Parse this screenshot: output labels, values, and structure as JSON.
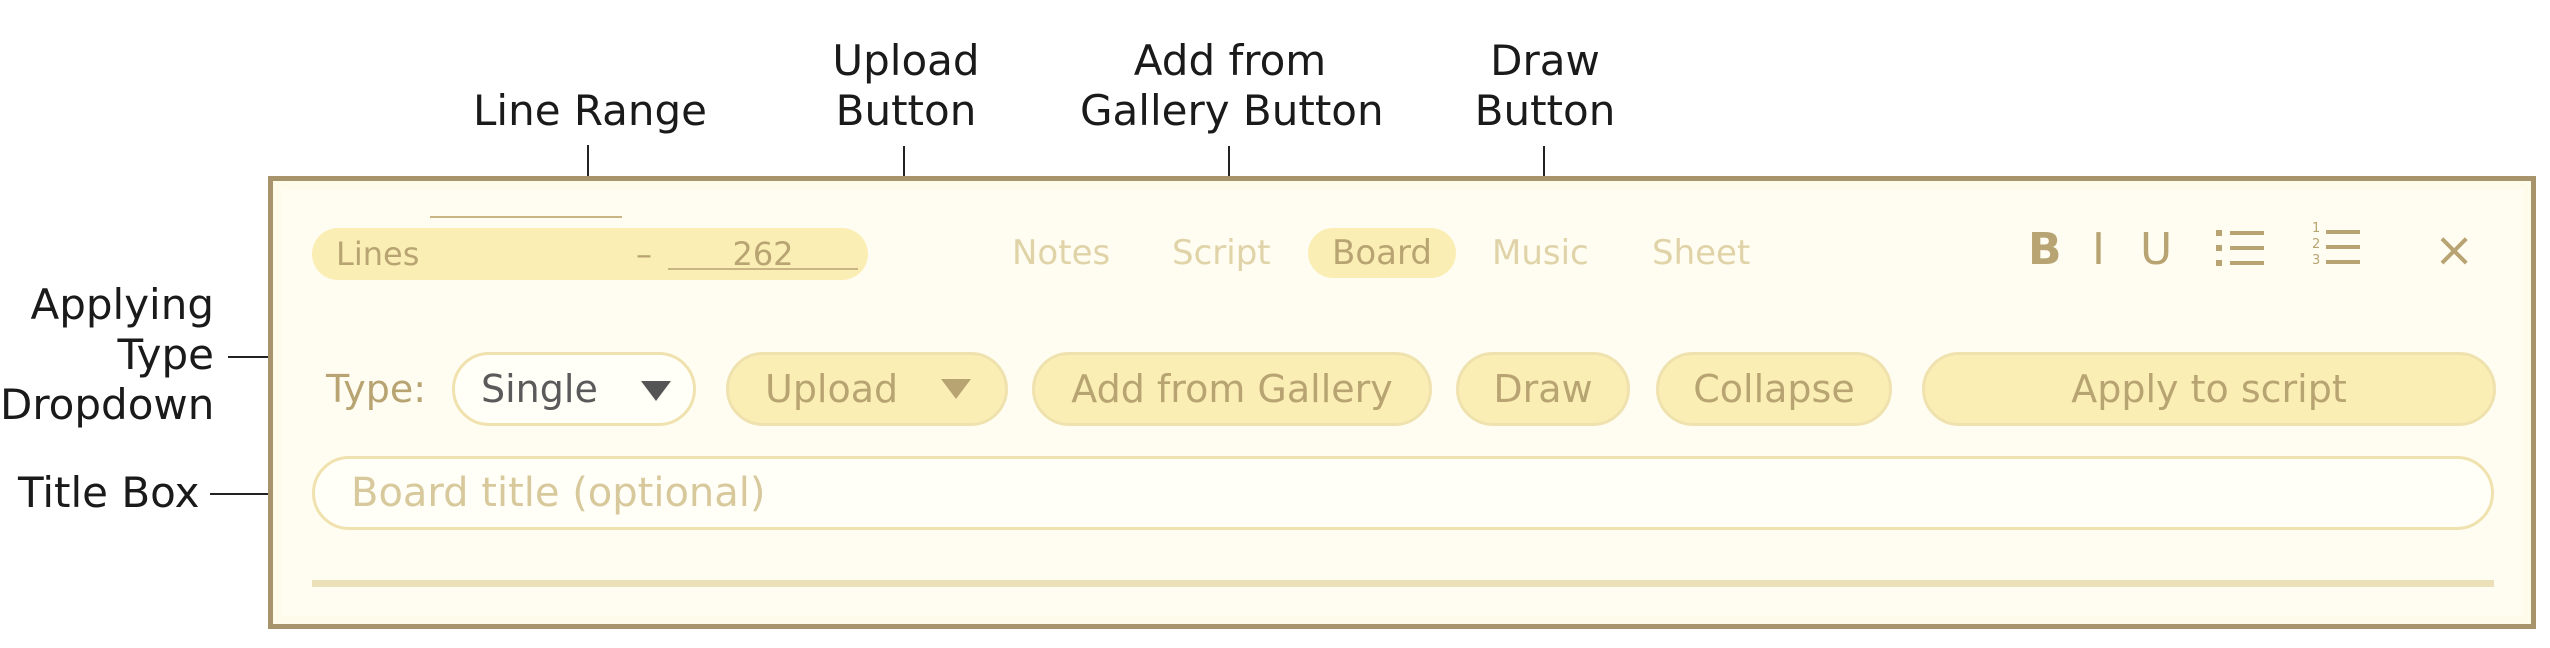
{
  "annotations": {
    "line_range": "Line Range",
    "upload_line1": "Upload",
    "upload_line2": "Button",
    "gallery_line1": "Add from",
    "gallery_line2": "Gallery Button",
    "draw_line1": "Draw",
    "draw_line2": "Button",
    "applying_line1": "Applying",
    "applying_line2": "Type",
    "applying_line3": "Dropdown",
    "title_box": "Title Box"
  },
  "editor": {
    "line_range": {
      "label": "Lines",
      "start": "",
      "dash": "–",
      "end": "262"
    },
    "tabs": [
      {
        "label": "Notes",
        "active": false
      },
      {
        "label": "Script",
        "active": false
      },
      {
        "label": "Board",
        "active": true
      },
      {
        "label": "Music",
        "active": false
      },
      {
        "label": "Sheet",
        "active": false
      }
    ],
    "format": {
      "bold": "B",
      "italic": "I",
      "underline": "U",
      "bullet_icon": "bullet-list-icon",
      "numbered_icon": "numbered-list-icon",
      "close": "×"
    },
    "type_label": "Type:",
    "type_value": "Single",
    "buttons": {
      "upload": "Upload",
      "gallery": "Add from Gallery",
      "draw": "Draw",
      "collapse": "Collapse",
      "apply": "Apply to script"
    },
    "title_placeholder": "Board title (optional)"
  },
  "colors": {
    "accent": "#b8a472",
    "pill_bg": "#fbeeb4",
    "panel_border": "#a8946c"
  }
}
